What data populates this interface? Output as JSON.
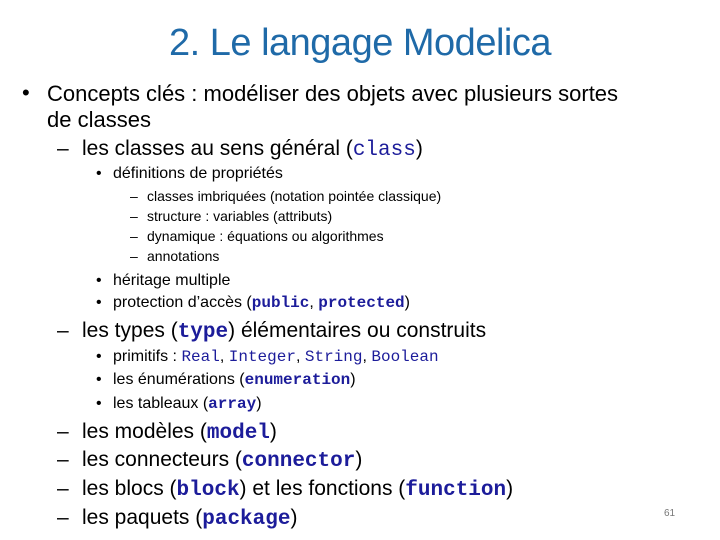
{
  "slide": {
    "title": "2. Le langage Modelica",
    "page_number": "61",
    "bullet_l1": "•",
    "bullet_l3": "•",
    "dash": "–",
    "intro": {
      "line1": "Concepts clés : modéliser des objets avec plusieurs sortes",
      "line2": "de classes"
    },
    "classes": {
      "prefix": "les classes au sens général (",
      "code": "class",
      "suffix": ")",
      "definitions": "définitions de propriétés",
      "sub_items": [
        "classes imbriquées (notation pointée classique)",
        "structure : variables (attributs)",
        "dynamique : équations ou algorithmes",
        "annotations"
      ],
      "heritage": "héritage multiple",
      "protection_prefix": "protection d’accès (",
      "protection_code1": "public",
      "protection_sep": ", ",
      "protection_code2": "protected",
      "protection_suffix": ")"
    },
    "types": {
      "prefix": "les types (",
      "code": "type",
      "suffix": ") élémentaires ou construits",
      "primitifs_label": "primitifs : ",
      "primitifs": [
        "Real",
        "Integer",
        "String",
        "Boolean"
      ],
      "enum_prefix": "les énumérations (",
      "enum_code": "enumeration",
      "enum_suffix": ")",
      "array_prefix": "les tableaux (",
      "array_code": "array",
      "array_suffix": ")"
    },
    "others": [
      {
        "prefix": "les modèles (",
        "code": "model",
        "suffix": ")"
      },
      {
        "prefix": "les connecteurs (",
        "code": "connector",
        "suffix": ")"
      },
      {
        "prefix": "les blocs (",
        "code": "block",
        "mid": ") et les fonctions (",
        "code2": "function",
        "suffix": ")"
      },
      {
        "prefix": "les paquets (",
        "code": "package",
        "suffix": ")"
      }
    ]
  }
}
